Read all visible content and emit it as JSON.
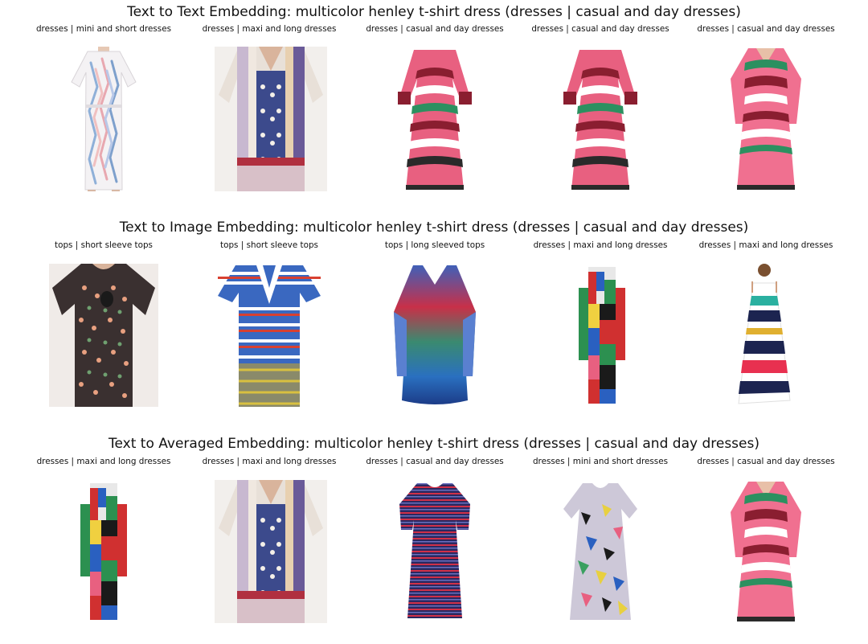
{
  "sections": [
    {
      "title": "Text to Text Embedding: multicolor henley t-shirt dress (dresses | casual and day dresses)",
      "items": [
        {
          "label": "dresses | mini and short dresses",
          "image": "mini-dress-pastel-brushstrokes"
        },
        {
          "label": "dresses | maxi and long dresses",
          "image": "maxi-dress-tribal-print"
        },
        {
          "label": "dresses | casual and day dresses",
          "image": "zigzag-knit-dress"
        },
        {
          "label": "dresses | casual and day dresses",
          "image": "zigzag-knit-dress"
        },
        {
          "label": "dresses | casual and day dresses",
          "image": "zigzag-vneck-dress"
        }
      ]
    },
    {
      "title": "Text to Image Embedding: multicolor henley t-shirt dress (dresses | casual and day dresses)",
      "items": [
        {
          "label": "tops | short sleeve tops",
          "image": "floral-print-tee"
        },
        {
          "label": "tops | short sleeve tops",
          "image": "striped-polo-knit-top"
        },
        {
          "label": "tops | long sleeved tops",
          "image": "tie-dye-vneck-top"
        },
        {
          "label": "dresses | maxi and long dresses",
          "image": "patchwork-maxi-dress"
        },
        {
          "label": "dresses | maxi and long dresses",
          "image": "striped-slip-maxi-dress"
        }
      ]
    },
    {
      "title": "Text to Averaged Embedding: multicolor henley t-shirt dress (dresses | casual and day dresses)",
      "items": [
        {
          "label": "dresses | maxi and long dresses",
          "image": "patchwork-maxi-dress"
        },
        {
          "label": "dresses | maxi and long dresses",
          "image": "maxi-dress-tribal-print"
        },
        {
          "label": "dresses | casual and day dresses",
          "image": "striped-knit-tshirt-dress"
        },
        {
          "label": "dresses | mini and short dresses",
          "image": "geometric-print-dress"
        },
        {
          "label": "dresses | casual and day dresses",
          "image": "zigzag-vneck-dress"
        }
      ]
    }
  ]
}
